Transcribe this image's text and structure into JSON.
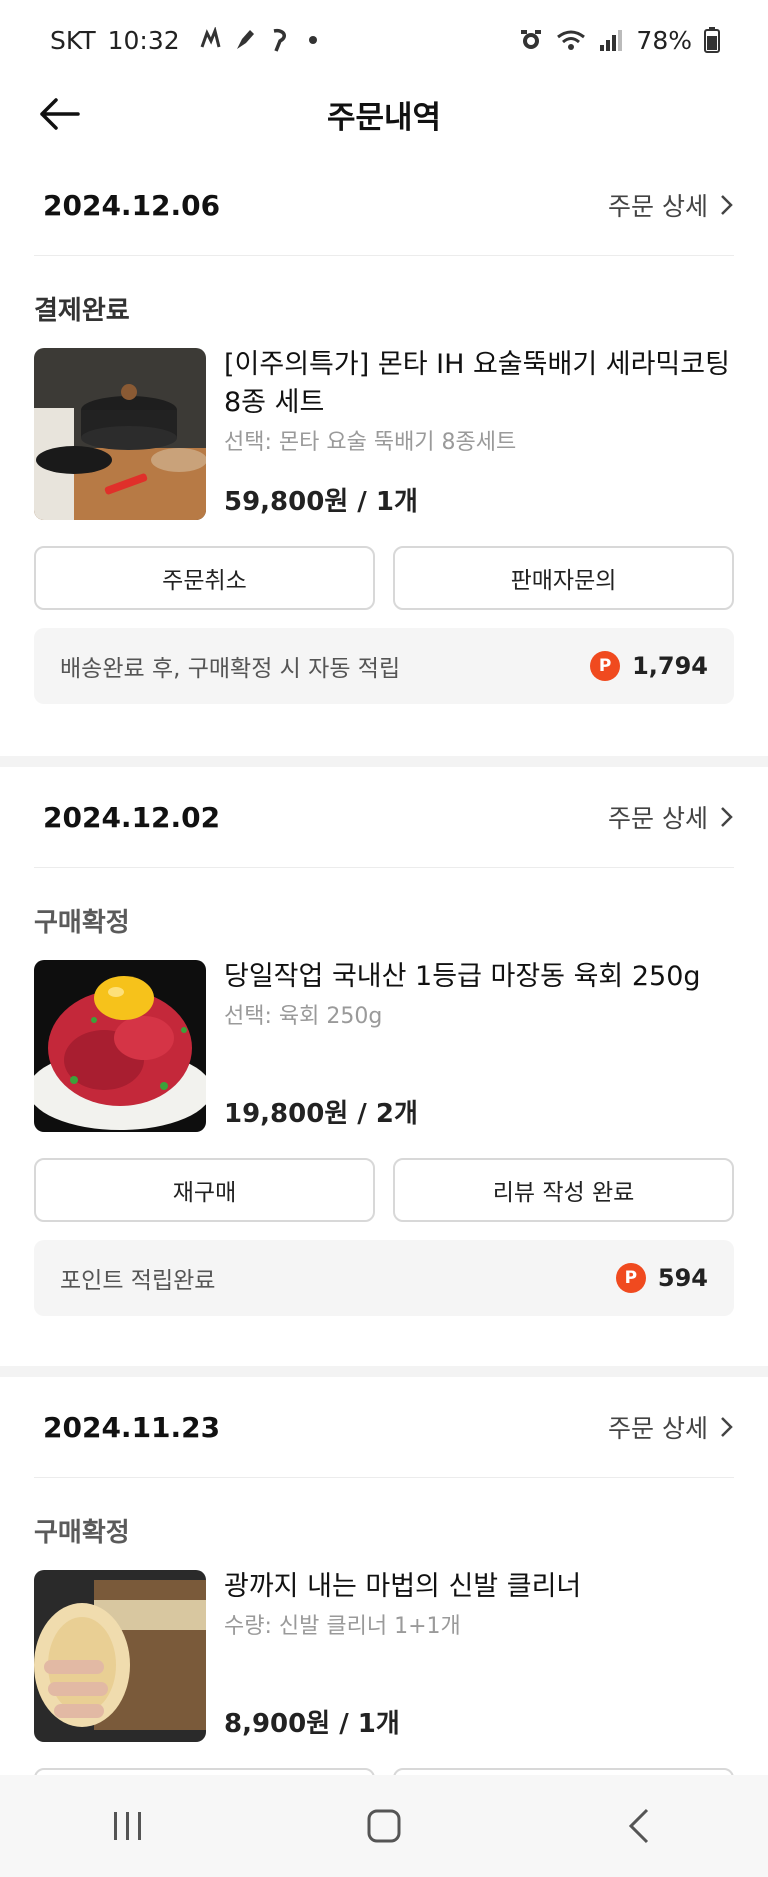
{
  "status_bar": {
    "carrier": "SKT",
    "time": "10:32",
    "battery": "78%"
  },
  "header": {
    "title": "주문내역"
  },
  "orders": [
    {
      "date": "2024.12.06",
      "detail_link": "주문 상세",
      "status": "결제완료",
      "product_name": "[이주의특가] 몬타 IH 요술뚝배기 세라믹코팅 8종 세트",
      "option": "선택: 몬타 요술 뚝배기 8종세트",
      "price_qty": "59,800원 / 1개",
      "buttons": [
        "주문취소",
        "판매자문의"
      ],
      "point_text": "배송완료 후, 구매확정 시 자동 적립",
      "points": "1,794",
      "thumb_icon": "ceramic-pot-image"
    },
    {
      "date": "2024.12.02",
      "detail_link": "주문 상세",
      "status": "구매확정",
      "product_name": "당일작업 국내산 1등급 마장동 육회 250g",
      "option": "선택: 육회 250g",
      "price_qty": "19,800원 / 2개",
      "buttons": [
        "재구매",
        "리뷰 작성 완료"
      ],
      "point_text": "포인트 적립완료",
      "points": "594",
      "thumb_icon": "beef-tartare-image"
    },
    {
      "date": "2024.11.23",
      "detail_link": "주문 상세",
      "status": "구매확정",
      "product_name": "광까지 내는 마법의 신발 클리너",
      "option": "수량: 신발 클리너 1+1개",
      "price_qty": "8,900원 / 1개",
      "thumb_icon": "shoe-cleaner-image"
    }
  ],
  "point_badge": "P",
  "colors": {
    "point_badge": "#f04a1f",
    "divider": "#f3f3f3",
    "point_box": "#f5f5f5"
  }
}
